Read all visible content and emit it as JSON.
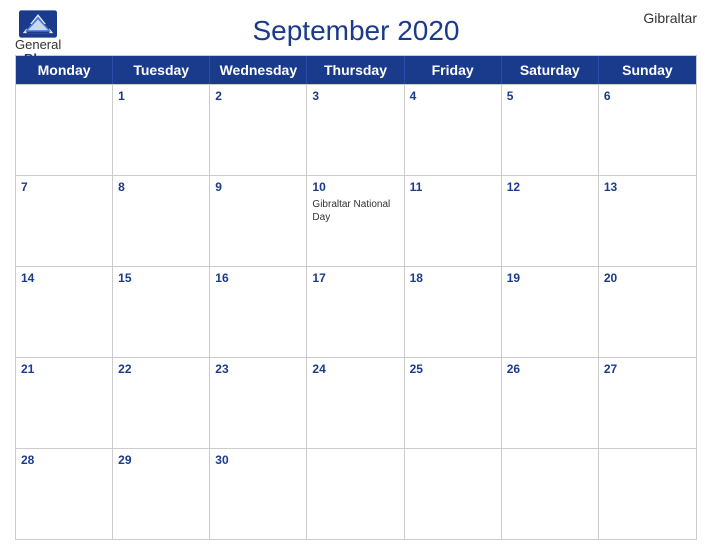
{
  "header": {
    "logo": {
      "general": "General",
      "blue": "Blue"
    },
    "title": "September 2020",
    "country": "Gibraltar"
  },
  "calendar": {
    "day_headers": [
      "Monday",
      "Tuesday",
      "Wednesday",
      "Thursday",
      "Friday",
      "Saturday",
      "Sunday"
    ],
    "weeks": [
      {
        "days": [
          {
            "date": "",
            "events": []
          },
          {
            "date": "1",
            "events": []
          },
          {
            "date": "2",
            "events": []
          },
          {
            "date": "3",
            "events": []
          },
          {
            "date": "4",
            "events": []
          },
          {
            "date": "5",
            "events": []
          },
          {
            "date": "6",
            "events": []
          }
        ]
      },
      {
        "days": [
          {
            "date": "7",
            "events": []
          },
          {
            "date": "8",
            "events": []
          },
          {
            "date": "9",
            "events": []
          },
          {
            "date": "10",
            "events": [
              "Gibraltar National Day"
            ]
          },
          {
            "date": "11",
            "events": []
          },
          {
            "date": "12",
            "events": []
          },
          {
            "date": "13",
            "events": []
          }
        ]
      },
      {
        "days": [
          {
            "date": "14",
            "events": []
          },
          {
            "date": "15",
            "events": []
          },
          {
            "date": "16",
            "events": []
          },
          {
            "date": "17",
            "events": []
          },
          {
            "date": "18",
            "events": []
          },
          {
            "date": "19",
            "events": []
          },
          {
            "date": "20",
            "events": []
          }
        ]
      },
      {
        "days": [
          {
            "date": "21",
            "events": []
          },
          {
            "date": "22",
            "events": []
          },
          {
            "date": "23",
            "events": []
          },
          {
            "date": "24",
            "events": []
          },
          {
            "date": "25",
            "events": []
          },
          {
            "date": "26",
            "events": []
          },
          {
            "date": "27",
            "events": []
          }
        ]
      },
      {
        "days": [
          {
            "date": "28",
            "events": []
          },
          {
            "date": "29",
            "events": []
          },
          {
            "date": "30",
            "events": []
          },
          {
            "date": "",
            "events": []
          },
          {
            "date": "",
            "events": []
          },
          {
            "date": "",
            "events": []
          },
          {
            "date": "",
            "events": []
          }
        ]
      }
    ]
  },
  "colors": {
    "header_bg": "#1a3a8c",
    "header_text": "#ffffff",
    "title_color": "#1a3a8c",
    "date_color": "#1a3a8c"
  }
}
